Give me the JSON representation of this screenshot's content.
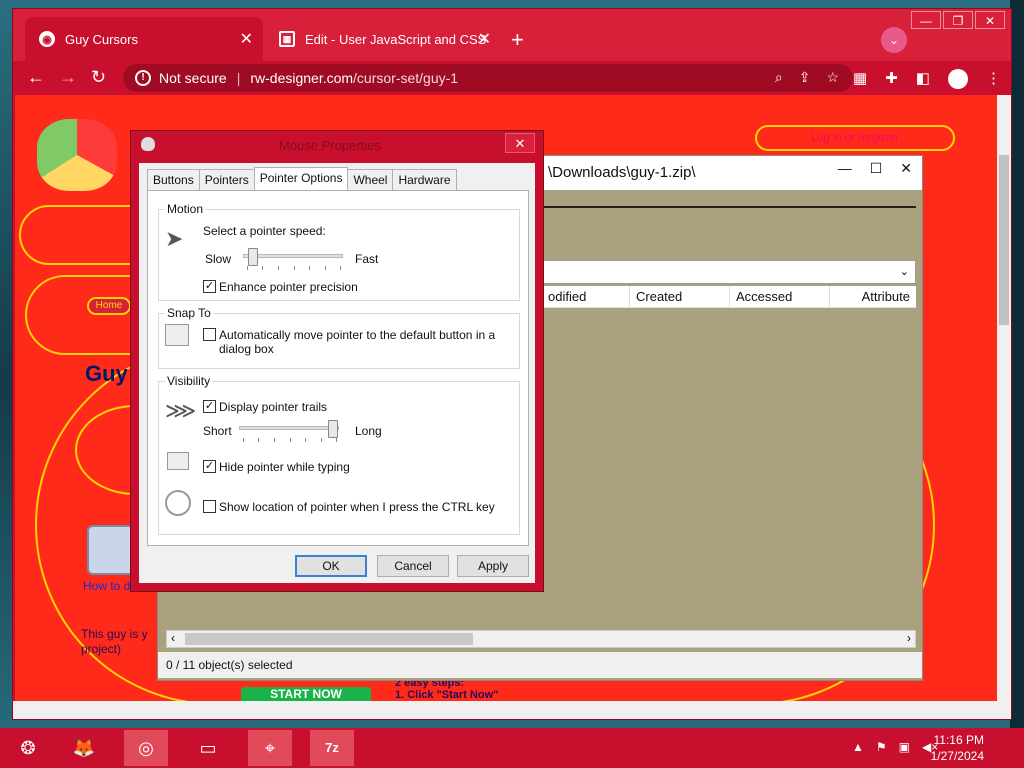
{
  "browser": {
    "tabs": [
      {
        "title": "Guy Cursors",
        "active": true
      },
      {
        "title": "Edit - User JavaScript and CSS",
        "active": false
      }
    ],
    "address": {
      "security": "Not secure",
      "host": "rw-designer.com",
      "path": "/cursor-set/guy-1"
    },
    "accent_color": "#c8102e"
  },
  "page": {
    "login_text": "Log In or Register",
    "home_label": "Home",
    "heading": "Guy",
    "howto": "How to d",
    "desc_line1": "This guy is y",
    "desc_line2": "project)",
    "start_button": "START NOW",
    "steps_title": "2 easy steps:",
    "steps_item": "1. Click \"Start Now\""
  },
  "zip": {
    "path": "\\Downloads\\guy-1.zip\\",
    "columns": [
      "odified",
      "Created",
      "Accessed",
      "Attribute"
    ],
    "status": "0 / 11 object(s) selected"
  },
  "dialog": {
    "title": "Mouse Properties",
    "tabs": [
      "Buttons",
      "Pointers",
      "Pointer Options",
      "Wheel",
      "Hardware"
    ],
    "selected_tab": "Pointer Options",
    "motion": {
      "legend": "Motion",
      "prompt": "Select a pointer speed:",
      "slow": "Slow",
      "fast": "Fast",
      "speed_level": 0.05,
      "precision_label": "Enhance pointer precision",
      "precision_checked": true
    },
    "snap": {
      "legend": "Snap To",
      "label_line1": "Automatically move pointer to the default button in a",
      "label_line2": "dialog box",
      "checked": false
    },
    "visibility": {
      "legend": "Visibility",
      "trails_label": "Display pointer trails",
      "trails_checked": true,
      "short": "Short",
      "long": "Long",
      "trail_level": 1.0,
      "hide_label": "Hide pointer while typing",
      "hide_checked": true,
      "ctrl_label": "Show location of pointer when I press the CTRL key",
      "ctrl_checked": false
    },
    "buttons": {
      "ok": "OK",
      "cancel": "Cancel",
      "apply": "Apply"
    }
  },
  "taskbar": {
    "time": "11:16 PM",
    "date": "1/27/2024",
    "apps": [
      "Firefox",
      "Chrome",
      "File Explorer",
      "Mouse",
      "7-Zip"
    ],
    "zip_label": "7z"
  }
}
